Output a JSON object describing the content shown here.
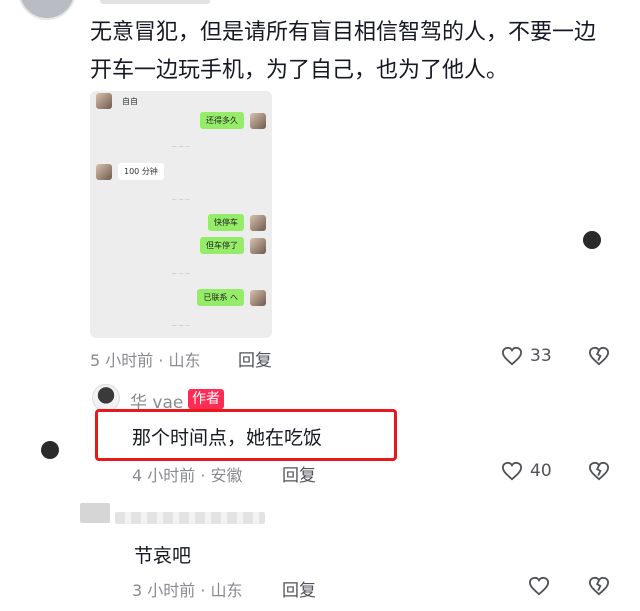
{
  "comment1": {
    "text_line1": "无意冒犯，但是请所有盲目相信智驾的人，不要一边",
    "text_line2": "开车一边玩手机，为了自己，也为了他人。",
    "chat": {
      "msg_left_top": "自自",
      "msg_right_1": "还得多久",
      "msg_left_2": "100 分钟",
      "msg_right_2": "快停车",
      "msg_right_3": "但车停了",
      "msg_right_4": "已联系 へ"
    },
    "time": "5 小时前 · 山东",
    "reply_label": "回复",
    "likes": "33"
  },
  "reply1": {
    "author": "华 vae",
    "author_tag": "作者",
    "text": "那个时间点，她在吃饭",
    "time": "4 小时前 · 安徽",
    "reply_label": "回复",
    "likes": "40"
  },
  "comment2": {
    "text": "节哀吧",
    "time": "3 小时前 · 山东",
    "reply_label": "回复"
  }
}
